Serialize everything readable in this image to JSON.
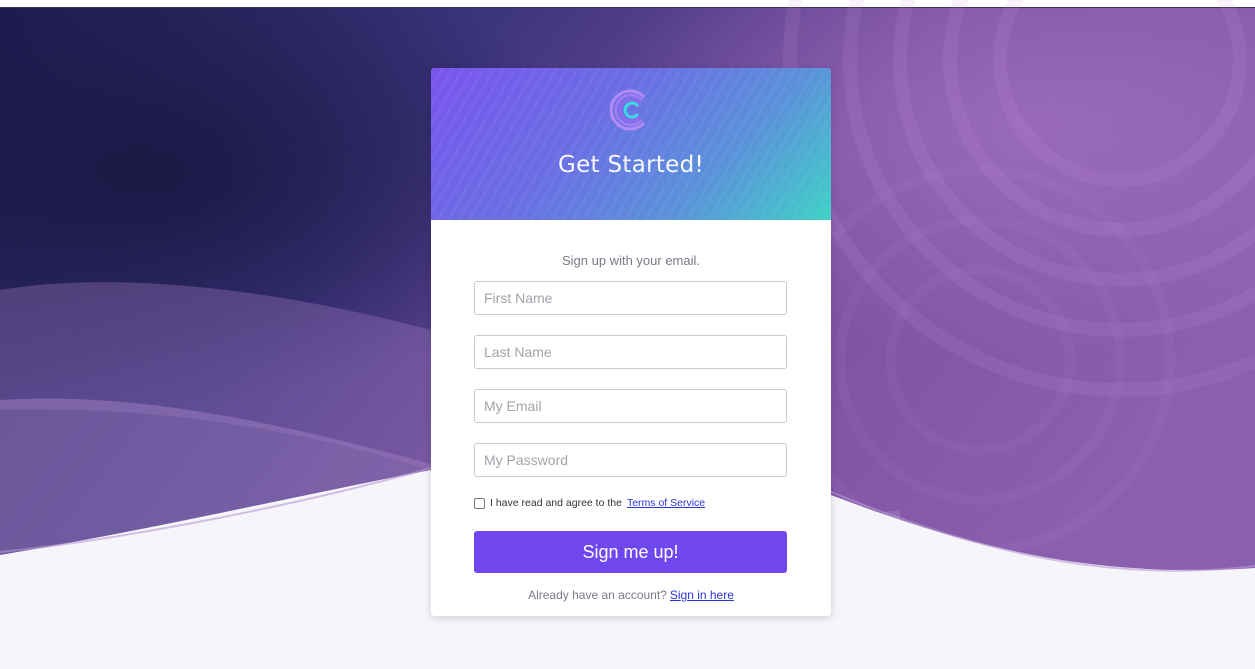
{
  "header": {
    "logo_icon": "c-circle-logo-icon",
    "title": "Get Started!"
  },
  "form": {
    "subtitle": "Sign up with your email.",
    "first_name": {
      "value": "",
      "placeholder": "First Name"
    },
    "last_name": {
      "value": "",
      "placeholder": "Last Name"
    },
    "email": {
      "value": "",
      "placeholder": "My Email"
    },
    "password": {
      "value": "",
      "placeholder": "My Password"
    },
    "terms": {
      "checked": false,
      "text": "I have read and agree to the",
      "link_label": "Terms of Service"
    },
    "submit_label": "Sign me up!",
    "signin": {
      "text": "Already have an account?",
      "link_label": "Sign in here"
    }
  },
  "colors": {
    "accent": "#7047ee",
    "link": "#2a35d8",
    "header_gradient_start": "#7a55ee",
    "header_gradient_end": "#3fd1c6"
  }
}
